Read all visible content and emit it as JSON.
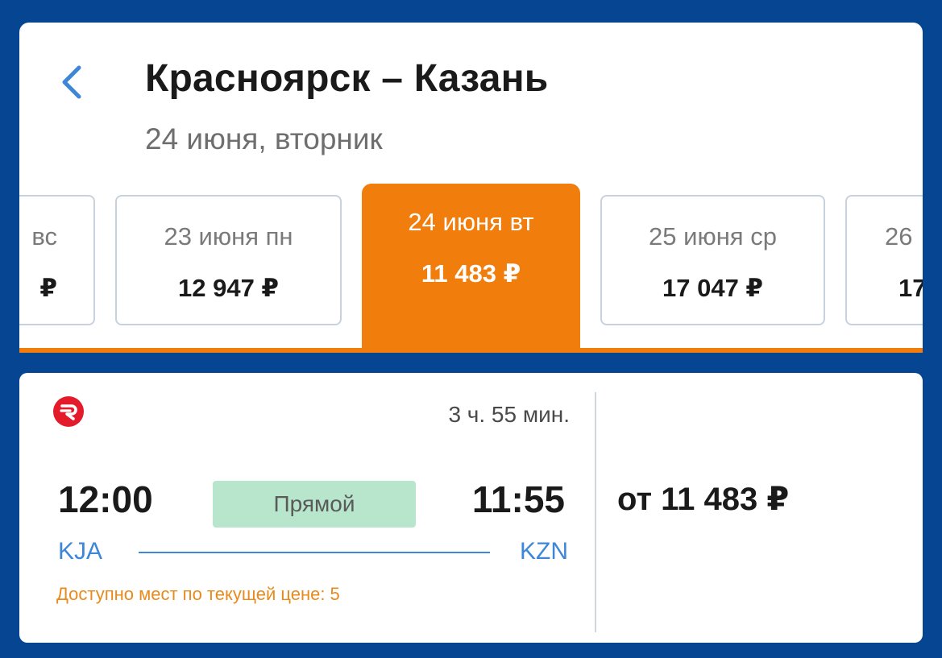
{
  "header": {
    "back_icon": "chevron-left-icon",
    "title": "Красноярск – Казань",
    "date": "24 июня, вторник"
  },
  "date_tabs": [
    {
      "date": "вс",
      "price": "₽",
      "selected": false,
      "partial": "left"
    },
    {
      "date": "23 июня пн",
      "price": "12 947 ₽",
      "selected": false
    },
    {
      "date": "24 июня вт",
      "price": "11 483 ₽",
      "selected": true
    },
    {
      "date": "25 июня ср",
      "price": "17 047 ₽",
      "selected": false
    },
    {
      "date": "26",
      "price": "17",
      "selected": false,
      "partial": "right"
    }
  ],
  "flight": {
    "airline_logo": "airline-logo-red-r",
    "duration": "3 ч. 55 мин.",
    "departure_time": "12:00",
    "arrival_time": "11:55",
    "stop_label": "Прямой",
    "departure_code": "KJA",
    "arrival_code": "KZN",
    "seats_note": "Доступно мест по текущей цене: 5",
    "price": "от 11 483 ₽"
  },
  "colors": {
    "background": "#054592",
    "accent_orange": "#f07d0c",
    "link_blue": "#3d86d8",
    "direct_badge": "#b8e6cc",
    "airline_red": "#e31b2a"
  }
}
